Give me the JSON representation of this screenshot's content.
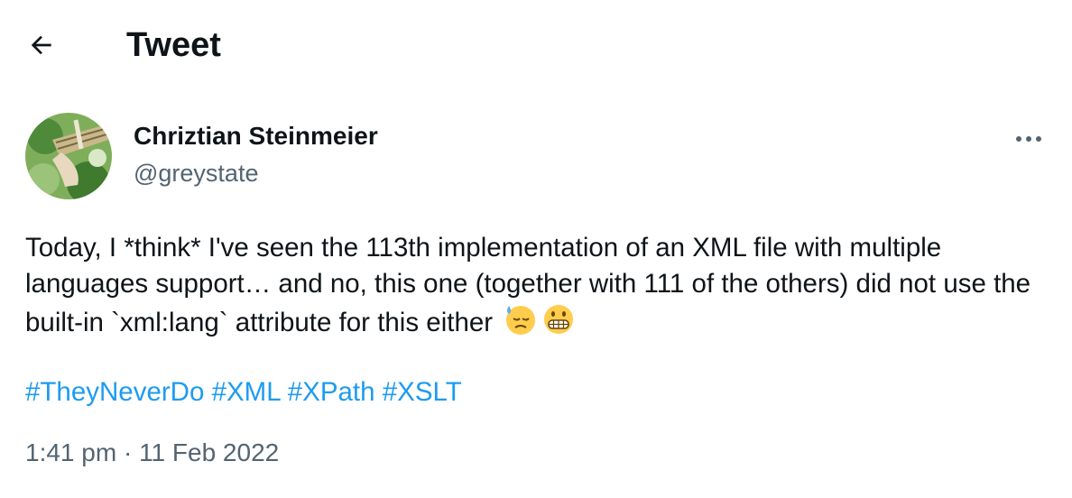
{
  "header": {
    "title": "Tweet",
    "back_icon": "arrow-left-icon"
  },
  "author": {
    "name": "Chriztian Steinmeier",
    "handle": "@greystate",
    "avatar_icon": "avatar-photo"
  },
  "more_icon": "ellipsis-icon",
  "tweet": {
    "text": "Today, I *think* I've seen the 113th implementation of an XML file with multiple languages support… and no, this one (together with 111 of the others) did not use the built-in `xml:lang` attribute for this either",
    "emojis": [
      "downcast-face-with-sweat-emoji",
      "grimacing-face-emoji"
    ],
    "hashtags": [
      "#TheyNeverDo",
      "#XML",
      "#XPath",
      "#XSLT"
    ]
  },
  "meta": {
    "time": "1:41 pm",
    "separator": "·",
    "date": "11 Feb 2022"
  },
  "colors": {
    "link": "#1d9bf0",
    "muted": "#536471",
    "text": "#0f1419"
  }
}
